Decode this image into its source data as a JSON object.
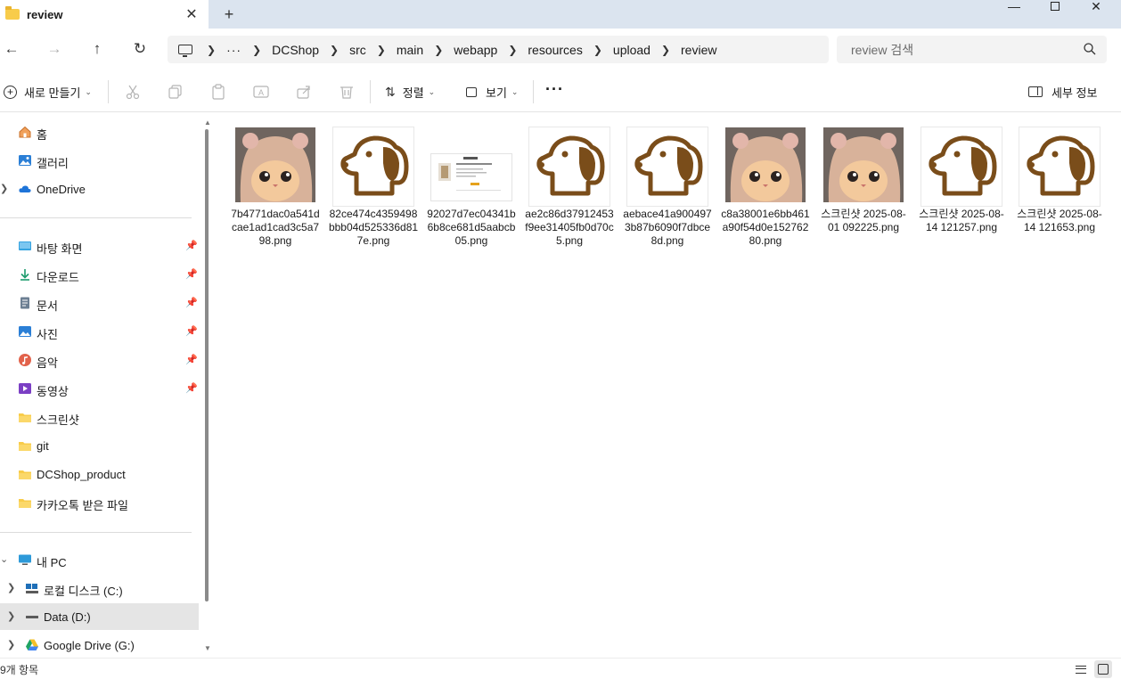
{
  "window": {
    "tab_title": "review",
    "tab_close": "✕",
    "new_tab": "+",
    "minimize": "—",
    "close": "✕"
  },
  "nav": {
    "back": "←",
    "forward": "→",
    "up": "↑",
    "refresh": "↻"
  },
  "breadcrumb": {
    "more": "···",
    "items": [
      "DCShop",
      "src",
      "main",
      "webapp",
      "resources",
      "upload",
      "review"
    ]
  },
  "search": {
    "placeholder": "review 검색"
  },
  "commandbar": {
    "new": "새로 만들기",
    "sort": "정렬",
    "view": "보기",
    "more": "···",
    "details": "세부 정보"
  },
  "sidebar": {
    "quick": [
      {
        "label": "홈",
        "icon": "home-icon"
      },
      {
        "label": "갤러리",
        "icon": "gallery-icon"
      },
      {
        "label": "OneDrive",
        "icon": "cloud-icon",
        "expandable": true
      }
    ],
    "pinned": [
      {
        "label": "바탕 화면",
        "icon": "desktop-icon",
        "pinned": true
      },
      {
        "label": "다운로드",
        "icon": "download-icon",
        "pinned": true
      },
      {
        "label": "문서",
        "icon": "document-icon",
        "pinned": true
      },
      {
        "label": "사진",
        "icon": "pictures-icon",
        "pinned": true
      },
      {
        "label": "음악",
        "icon": "music-icon",
        "pinned": true
      },
      {
        "label": "동영상",
        "icon": "video-icon",
        "pinned": true
      },
      {
        "label": "스크린샷",
        "icon": "folder-icon"
      },
      {
        "label": "git",
        "icon": "folder-icon"
      },
      {
        "label": "DCShop_product",
        "icon": "folder-icon"
      },
      {
        "label": "카카오톡 받은 파일",
        "icon": "folder-icon"
      }
    ],
    "pc": {
      "label": "내 PC",
      "icon": "pc-icon"
    },
    "drives": [
      {
        "label": "로컬 디스크 (C:)",
        "icon": "drive-c-icon",
        "selected": false
      },
      {
        "label": "Data (D:)",
        "icon": "drive-d-icon",
        "selected": true
      },
      {
        "label": "Google Drive (G:)",
        "icon": "google-drive-icon",
        "selected": false
      }
    ]
  },
  "files": [
    {
      "name": "7b4771dac0a541dcae1ad1cad3c5a798.png",
      "thumb": "cat"
    },
    {
      "name": "82ce474c4359498bbb04d525336d817e.png",
      "thumb": "dog"
    },
    {
      "name": "92027d7ec04341b6b8ce681d5aabcb05.png",
      "thumb": "doc"
    },
    {
      "name": "ae2c86d37912453f9ee31405fb0d70c5.png",
      "thumb": "dog"
    },
    {
      "name": "aebace41a9004973b87b6090f7dbce8d.png",
      "thumb": "dog"
    },
    {
      "name": "c8a38001e6bb461a90f54d0e15276280.png",
      "thumb": "cat"
    },
    {
      "name": "스크린샷 2025-08-01 092225.png",
      "thumb": "cat"
    },
    {
      "name": "스크린샷 2025-08-14 121257.png",
      "thumb": "dog"
    },
    {
      "name": "스크린샷 2025-08-14 121653.png",
      "thumb": "dog"
    }
  ],
  "status": {
    "item_count": "9개 항목"
  },
  "colors": {
    "titlebar": "#dbe4ef",
    "folder": "#f8cc4a",
    "dog_icon": "#7a4d1a",
    "selected_row": "#e5e5e5"
  }
}
